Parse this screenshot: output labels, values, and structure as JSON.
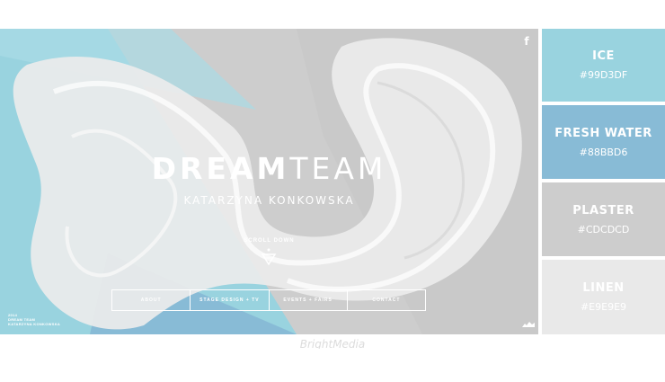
{
  "hero": {
    "title_bold": "DREAM",
    "title_light": "TEAM",
    "subtitle": "KATARZYNA KONKOWSKA",
    "scroll_label": "SCROLL DOWN",
    "facebook_glyph": "f",
    "nav": [
      "ABOUT",
      "STAGE DESIGN + TV",
      "EVENTS + FAIRS",
      "CONTACT"
    ],
    "credit": [
      "2014",
      "DREAM TEAM",
      "KATARZYNA KONKOWSKA"
    ],
    "colors": {
      "blue": "#99D3DF",
      "deep_blue": "#88BBD6",
      "grey": "#CDCDCD",
      "white": "#E9E9E9"
    }
  },
  "palette": [
    {
      "name": "ICE",
      "hex": "#99D3DF",
      "color": "#99D3DF"
    },
    {
      "name": "FRESH WATER",
      "hex": "#88BBD6",
      "color": "#88BBD6"
    },
    {
      "name": "PLASTER",
      "hex": "#CDCDCD",
      "color": "#CDCDCD"
    },
    {
      "name": "LINEN",
      "hex": "#E9E9E9",
      "color": "#E9E9E9"
    }
  ],
  "watermark": "BrightMedia"
}
